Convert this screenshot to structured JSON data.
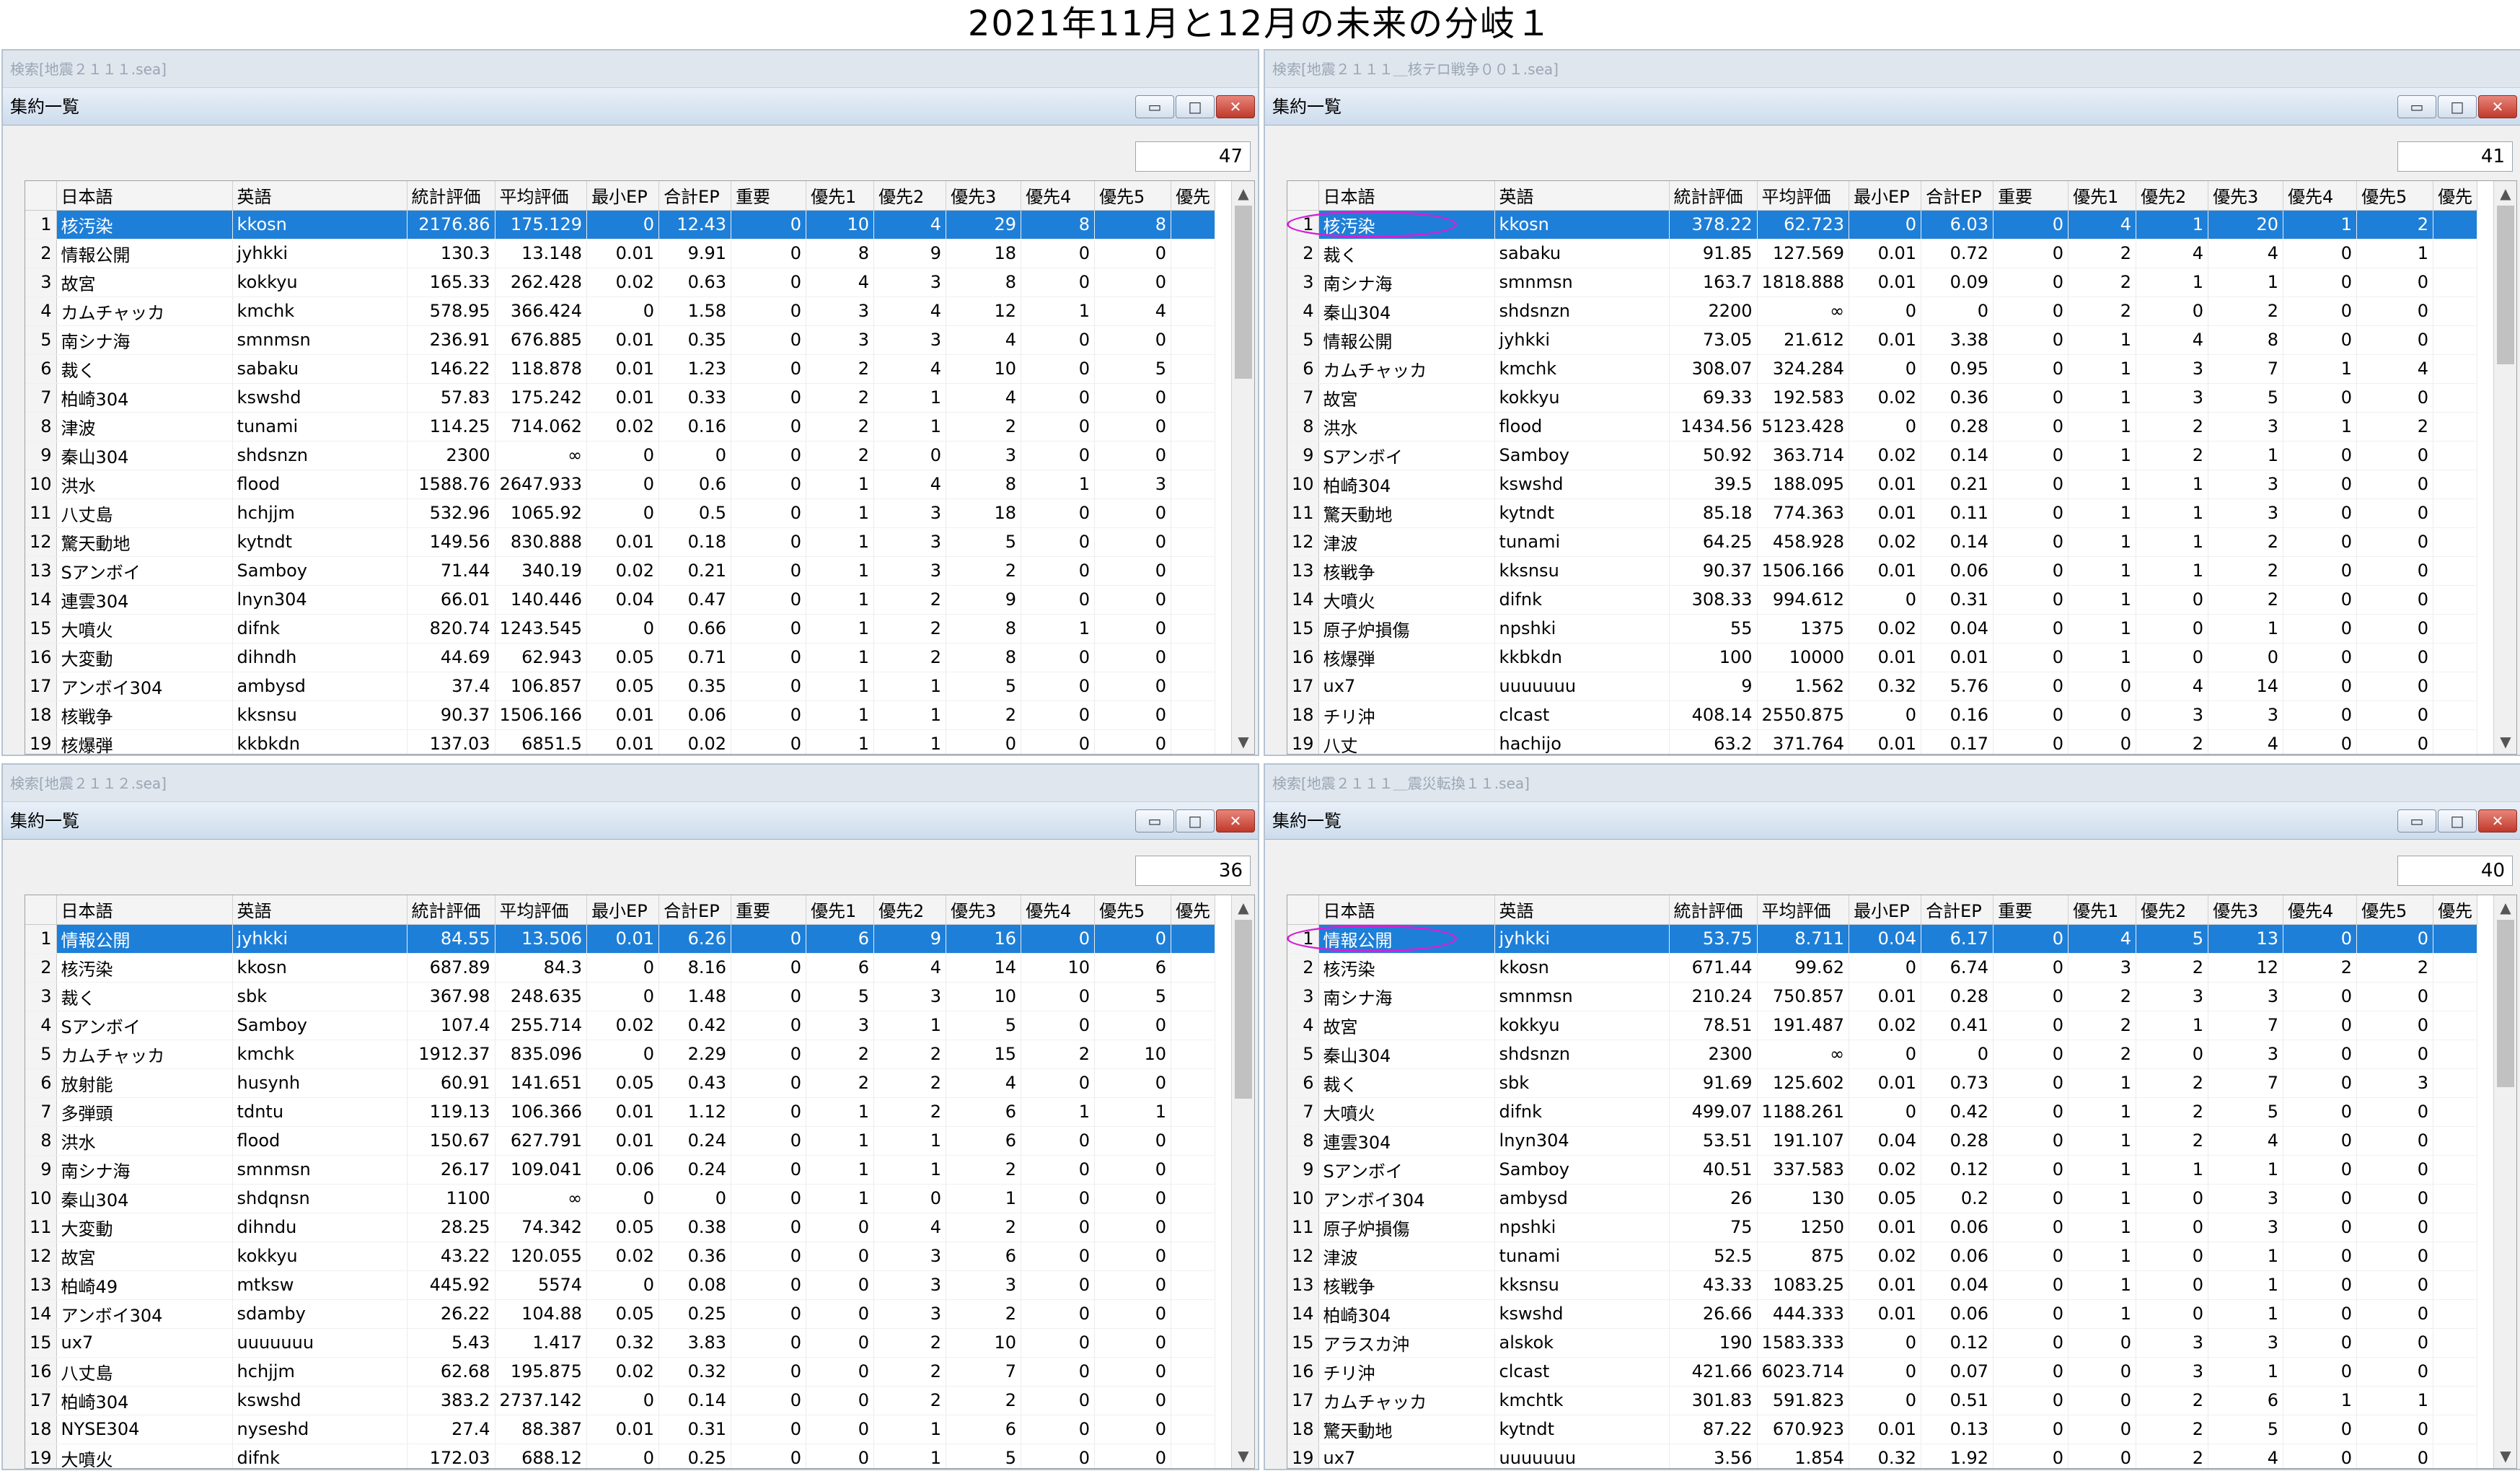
{
  "page_title": "2021年11月と12月の未来の分岐１",
  "colors": {
    "selection": "#1e7fd8",
    "circle": "#d61fd6",
    "close": "#c0392b"
  },
  "columns": [
    "日本語",
    "英語",
    "統計評価",
    "平均評価",
    "最小EP",
    "合計EP",
    "重要",
    "優先1",
    "優先2",
    "優先3",
    "優先4",
    "優先5",
    "優先"
  ],
  "panels": [
    {
      "search": "検索[地震２１１１.sea]",
      "title": "集約一覧",
      "count": "47",
      "thumb": 0.6,
      "circle": false,
      "rows": [
        [
          "1",
          "核汚染",
          "kkosn",
          "2176.86",
          "175.129",
          "0",
          "12.43",
          "0",
          "10",
          "4",
          "29",
          "8",
          "8"
        ],
        [
          "2",
          "情報公開",
          "jyhkki",
          "130.3",
          "13.148",
          "0.01",
          "9.91",
          "0",
          "8",
          "9",
          "18",
          "0",
          "0"
        ],
        [
          "3",
          "故宮",
          "kokkyu",
          "165.33",
          "262.428",
          "0.02",
          "0.63",
          "0",
          "4",
          "3",
          "8",
          "0",
          "0"
        ],
        [
          "4",
          "カムチャッカ",
          "kmchk",
          "578.95",
          "366.424",
          "0",
          "1.58",
          "0",
          "3",
          "4",
          "12",
          "1",
          "4"
        ],
        [
          "5",
          "南シナ海",
          "smnmsn",
          "236.91",
          "676.885",
          "0.01",
          "0.35",
          "0",
          "3",
          "3",
          "4",
          "0",
          "0"
        ],
        [
          "6",
          "裁く",
          "sabaku",
          "146.22",
          "118.878",
          "0.01",
          "1.23",
          "0",
          "2",
          "4",
          "10",
          "0",
          "5"
        ],
        [
          "7",
          "柏崎304",
          "kswshd",
          "57.83",
          "175.242",
          "0.01",
          "0.33",
          "0",
          "2",
          "1",
          "4",
          "0",
          "0"
        ],
        [
          "8",
          "津波",
          "tunami",
          "114.25",
          "714.062",
          "0.02",
          "0.16",
          "0",
          "2",
          "1",
          "2",
          "0",
          "0"
        ],
        [
          "9",
          "秦山304",
          "shdsnzn",
          "2300",
          "∞",
          "0",
          "0",
          "0",
          "2",
          "0",
          "3",
          "0",
          "0"
        ],
        [
          "10",
          "洪水",
          "flood",
          "1588.76",
          "2647.933",
          "0",
          "0.6",
          "0",
          "1",
          "4",
          "8",
          "1",
          "3"
        ],
        [
          "11",
          "八丈島",
          "hchjjm",
          "532.96",
          "1065.92",
          "0",
          "0.5",
          "0",
          "1",
          "3",
          "18",
          "0",
          "0"
        ],
        [
          "12",
          "驚天動地",
          "kytndt",
          "149.56",
          "830.888",
          "0.01",
          "0.18",
          "0",
          "1",
          "3",
          "5",
          "0",
          "0"
        ],
        [
          "13",
          "Sアンボイ",
          "Samboy",
          "71.44",
          "340.19",
          "0.02",
          "0.21",
          "0",
          "1",
          "3",
          "2",
          "0",
          "0"
        ],
        [
          "14",
          "連雲304",
          "lnyn304",
          "66.01",
          "140.446",
          "0.04",
          "0.47",
          "0",
          "1",
          "2",
          "9",
          "0",
          "0"
        ],
        [
          "15",
          "大噴火",
          "difnk",
          "820.74",
          "1243.545",
          "0",
          "0.66",
          "0",
          "1",
          "2",
          "8",
          "1",
          "0"
        ],
        [
          "16",
          "大変動",
          "dihndh",
          "44.69",
          "62.943",
          "0.05",
          "0.71",
          "0",
          "1",
          "2",
          "8",
          "0",
          "0"
        ],
        [
          "17",
          "アンボイ304",
          "ambysd",
          "37.4",
          "106.857",
          "0.05",
          "0.35",
          "0",
          "1",
          "1",
          "5",
          "0",
          "0"
        ],
        [
          "18",
          "核戦争",
          "kksnsu",
          "90.37",
          "1506.166",
          "0.01",
          "0.06",
          "0",
          "1",
          "1",
          "2",
          "0",
          "0"
        ],
        [
          "19",
          "核爆弾",
          "kkbkdn",
          "137.03",
          "6851.5",
          "0.01",
          "0.02",
          "0",
          "1",
          "1",
          "0",
          "0",
          "0"
        ]
      ]
    },
    {
      "search": "検索[地震２１１１＿核テロ戦争００１.sea]",
      "title": "集約一覧",
      "count": "41",
      "thumb": 0.55,
      "circle": true,
      "rows": [
        [
          "1",
          "核汚染",
          "kkosn",
          "378.22",
          "62.723",
          "0",
          "6.03",
          "0",
          "4",
          "1",
          "20",
          "1",
          "2"
        ],
        [
          "2",
          "裁く",
          "sabaku",
          "91.85",
          "127.569",
          "0.01",
          "0.72",
          "0",
          "2",
          "4",
          "4",
          "0",
          "1"
        ],
        [
          "3",
          "南シナ海",
          "smnmsn",
          "163.7",
          "1818.888",
          "0.01",
          "0.09",
          "0",
          "2",
          "1",
          "1",
          "0",
          "0"
        ],
        [
          "4",
          "秦山304",
          "shdsnzn",
          "2200",
          "∞",
          "0",
          "0",
          "0",
          "2",
          "0",
          "2",
          "0",
          "0"
        ],
        [
          "5",
          "情報公開",
          "jyhkki",
          "73.05",
          "21.612",
          "0.01",
          "3.38",
          "0",
          "1",
          "4",
          "8",
          "0",
          "0"
        ],
        [
          "6",
          "カムチャッカ",
          "kmchk",
          "308.07",
          "324.284",
          "0",
          "0.95",
          "0",
          "1",
          "3",
          "7",
          "1",
          "4"
        ],
        [
          "7",
          "故宮",
          "kokkyu",
          "69.33",
          "192.583",
          "0.02",
          "0.36",
          "0",
          "1",
          "3",
          "5",
          "0",
          "0"
        ],
        [
          "8",
          "洪水",
          "flood",
          "1434.56",
          "5123.428",
          "0",
          "0.28",
          "0",
          "1",
          "2",
          "3",
          "1",
          "2"
        ],
        [
          "9",
          "Sアンボイ",
          "Samboy",
          "50.92",
          "363.714",
          "0.02",
          "0.14",
          "0",
          "1",
          "2",
          "1",
          "0",
          "0"
        ],
        [
          "10",
          "柏崎304",
          "kswshd",
          "39.5",
          "188.095",
          "0.01",
          "0.21",
          "0",
          "1",
          "1",
          "3",
          "0",
          "0"
        ],
        [
          "11",
          "驚天動地",
          "kytndt",
          "85.18",
          "774.363",
          "0.01",
          "0.11",
          "0",
          "1",
          "1",
          "3",
          "0",
          "0"
        ],
        [
          "12",
          "津波",
          "tunami",
          "64.25",
          "458.928",
          "0.02",
          "0.14",
          "0",
          "1",
          "1",
          "2",
          "0",
          "0"
        ],
        [
          "13",
          "核戦争",
          "kksnsu",
          "90.37",
          "1506.166",
          "0.01",
          "0.06",
          "0",
          "1",
          "1",
          "2",
          "0",
          "0"
        ],
        [
          "14",
          "大噴火",
          "difnk",
          "308.33",
          "994.612",
          "0",
          "0.31",
          "0",
          "1",
          "0",
          "2",
          "0",
          "0"
        ],
        [
          "15",
          "原子炉損傷",
          "npshki",
          "55",
          "1375",
          "0.02",
          "0.04",
          "0",
          "1",
          "0",
          "1",
          "0",
          "0"
        ],
        [
          "16",
          "核爆弾",
          "kkbkdn",
          "100",
          "10000",
          "0.01",
          "0.01",
          "0",
          "1",
          "0",
          "0",
          "0",
          "0"
        ],
        [
          "17",
          "ux7",
          "uuuuuuu",
          "9",
          "1.562",
          "0.32",
          "5.76",
          "0",
          "0",
          "4",
          "14",
          "0",
          "0"
        ],
        [
          "18",
          "チリ沖",
          "clcast",
          "408.14",
          "2550.875",
          "0",
          "0.16",
          "0",
          "0",
          "3",
          "3",
          "0",
          "0"
        ],
        [
          "19",
          "八丈",
          "hachijo",
          "63.2",
          "371.764",
          "0.01",
          "0.17",
          "0",
          "0",
          "2",
          "4",
          "0",
          "0"
        ]
      ]
    },
    {
      "search": "検索[地震２１１２.sea]",
      "title": "集約一覧",
      "count": "36",
      "thumb": 0.62,
      "circle": false,
      "rows": [
        [
          "1",
          "情報公開",
          "jyhkki",
          "84.55",
          "13.506",
          "0.01",
          "6.26",
          "0",
          "6",
          "9",
          "16",
          "0",
          "0"
        ],
        [
          "2",
          "核汚染",
          "kkosn",
          "687.89",
          "84.3",
          "0",
          "8.16",
          "0",
          "6",
          "4",
          "14",
          "10",
          "6"
        ],
        [
          "3",
          "裁く",
          "sbk",
          "367.98",
          "248.635",
          "0",
          "1.48",
          "0",
          "5",
          "3",
          "10",
          "0",
          "5"
        ],
        [
          "4",
          "Sアンボイ",
          "Samboy",
          "107.4",
          "255.714",
          "0.02",
          "0.42",
          "0",
          "3",
          "1",
          "5",
          "0",
          "0"
        ],
        [
          "5",
          "カムチャッカ",
          "kmchk",
          "1912.37",
          "835.096",
          "0",
          "2.29",
          "0",
          "2",
          "2",
          "15",
          "2",
          "10"
        ],
        [
          "6",
          "放射能",
          "husynh",
          "60.91",
          "141.651",
          "0.05",
          "0.43",
          "0",
          "2",
          "2",
          "4",
          "0",
          "0"
        ],
        [
          "7",
          "多弾頭",
          "tdntu",
          "119.13",
          "106.366",
          "0.01",
          "1.12",
          "0",
          "1",
          "2",
          "6",
          "1",
          "1"
        ],
        [
          "8",
          "洪水",
          "flood",
          "150.67",
          "627.791",
          "0.01",
          "0.24",
          "0",
          "1",
          "1",
          "6",
          "0",
          "0"
        ],
        [
          "9",
          "南シナ海",
          "smnmsn",
          "26.17",
          "109.041",
          "0.06",
          "0.24",
          "0",
          "1",
          "1",
          "2",
          "0",
          "0"
        ],
        [
          "10",
          "秦山304",
          "shdqnsn",
          "1100",
          "∞",
          "0",
          "0",
          "0",
          "1",
          "0",
          "1",
          "0",
          "0"
        ],
        [
          "11",
          "大変動",
          "dihndu",
          "28.25",
          "74.342",
          "0.05",
          "0.38",
          "0",
          "0",
          "4",
          "2",
          "0",
          "0"
        ],
        [
          "12",
          "故宮",
          "kokkyu",
          "43.22",
          "120.055",
          "0.02",
          "0.36",
          "0",
          "0",
          "3",
          "6",
          "0",
          "0"
        ],
        [
          "13",
          "柏崎49",
          "mtksw",
          "445.92",
          "5574",
          "0",
          "0.08",
          "0",
          "0",
          "3",
          "3",
          "0",
          "0"
        ],
        [
          "14",
          "アンボイ304",
          "sdamby",
          "26.22",
          "104.88",
          "0.05",
          "0.25",
          "0",
          "0",
          "3",
          "2",
          "0",
          "0"
        ],
        [
          "15",
          "ux7",
          "uuuuuuu",
          "5.43",
          "1.417",
          "0.32",
          "3.83",
          "0",
          "0",
          "2",
          "10",
          "0",
          "0"
        ],
        [
          "16",
          "八丈島",
          "hchjjm",
          "62.68",
          "195.875",
          "0.02",
          "0.32",
          "0",
          "0",
          "2",
          "7",
          "0",
          "0"
        ],
        [
          "17",
          "柏崎304",
          "kswshd",
          "383.2",
          "2737.142",
          "0",
          "0.14",
          "0",
          "0",
          "2",
          "2",
          "0",
          "0"
        ],
        [
          "18",
          "NYSE304",
          "nyseshd",
          "27.4",
          "88.387",
          "0.01",
          "0.31",
          "0",
          "0",
          "1",
          "6",
          "0",
          "0"
        ],
        [
          "19",
          "大噴火",
          "difnk",
          "172.03",
          "688.12",
          "0",
          "0.25",
          "0",
          "0",
          "1",
          "5",
          "0",
          "0"
        ]
      ]
    },
    {
      "search": "検索[地震２１１１＿震災転換１１.sea]",
      "title": "集約一覧",
      "count": "40",
      "thumb": 0.58,
      "circle": true,
      "rows": [
        [
          "1",
          "情報公開",
          "jyhkki",
          "53.75",
          "8.711",
          "0.04",
          "6.17",
          "0",
          "4",
          "5",
          "13",
          "0",
          "0"
        ],
        [
          "2",
          "核汚染",
          "kkosn",
          "671.44",
          "99.62",
          "0",
          "6.74",
          "0",
          "3",
          "2",
          "12",
          "2",
          "2"
        ],
        [
          "3",
          "南シナ海",
          "smnmsn",
          "210.24",
          "750.857",
          "0.01",
          "0.28",
          "0",
          "2",
          "3",
          "3",
          "0",
          "0"
        ],
        [
          "4",
          "故宮",
          "kokkyu",
          "78.51",
          "191.487",
          "0.02",
          "0.41",
          "0",
          "2",
          "1",
          "7",
          "0",
          "0"
        ],
        [
          "5",
          "秦山304",
          "shdsnzn",
          "2300",
          "∞",
          "0",
          "0",
          "0",
          "2",
          "0",
          "3",
          "0",
          "0"
        ],
        [
          "6",
          "裁く",
          "sbk",
          "91.69",
          "125.602",
          "0.01",
          "0.73",
          "0",
          "1",
          "2",
          "7",
          "0",
          "3"
        ],
        [
          "7",
          "大噴火",
          "difnk",
          "499.07",
          "1188.261",
          "0",
          "0.42",
          "0",
          "1",
          "2",
          "5",
          "0",
          "0"
        ],
        [
          "8",
          "連雲304",
          "lnyn304",
          "53.51",
          "191.107",
          "0.04",
          "0.28",
          "0",
          "1",
          "2",
          "4",
          "0",
          "0"
        ],
        [
          "9",
          "Sアンボイ",
          "Samboy",
          "40.51",
          "337.583",
          "0.02",
          "0.12",
          "0",
          "1",
          "1",
          "1",
          "0",
          "0"
        ],
        [
          "10",
          "アンボイ304",
          "ambysd",
          "26",
          "130",
          "0.05",
          "0.2",
          "0",
          "1",
          "0",
          "3",
          "0",
          "0"
        ],
        [
          "11",
          "原子炉損傷",
          "npshki",
          "75",
          "1250",
          "0.01",
          "0.06",
          "0",
          "1",
          "0",
          "3",
          "0",
          "0"
        ],
        [
          "12",
          "津波",
          "tunami",
          "52.5",
          "875",
          "0.02",
          "0.06",
          "0",
          "1",
          "0",
          "1",
          "0",
          "0"
        ],
        [
          "13",
          "核戦争",
          "kksnsu",
          "43.33",
          "1083.25",
          "0.01",
          "0.04",
          "0",
          "1",
          "0",
          "1",
          "0",
          "0"
        ],
        [
          "14",
          "柏崎304",
          "kswshd",
          "26.66",
          "444.333",
          "0.01",
          "0.06",
          "0",
          "1",
          "0",
          "1",
          "0",
          "0"
        ],
        [
          "15",
          "アラスカ沖",
          "alskok",
          "190",
          "1583.333",
          "0",
          "0.12",
          "0",
          "0",
          "3",
          "3",
          "0",
          "0"
        ],
        [
          "16",
          "チリ沖",
          "clcast",
          "421.66",
          "6023.714",
          "0",
          "0.07",
          "0",
          "0",
          "3",
          "1",
          "0",
          "0"
        ],
        [
          "17",
          "カムチャッカ",
          "kmchtk",
          "301.83",
          "591.823",
          "0",
          "0.51",
          "0",
          "0",
          "2",
          "6",
          "1",
          "1"
        ],
        [
          "18",
          "驚天動地",
          "kytndt",
          "87.22",
          "670.923",
          "0.01",
          "0.13",
          "0",
          "0",
          "2",
          "5",
          "0",
          "0"
        ],
        [
          "19",
          "ux7",
          "uuuuuuu",
          "3.56",
          "1.854",
          "0.32",
          "1.92",
          "0",
          "0",
          "2",
          "4",
          "0",
          "0"
        ]
      ]
    }
  ]
}
